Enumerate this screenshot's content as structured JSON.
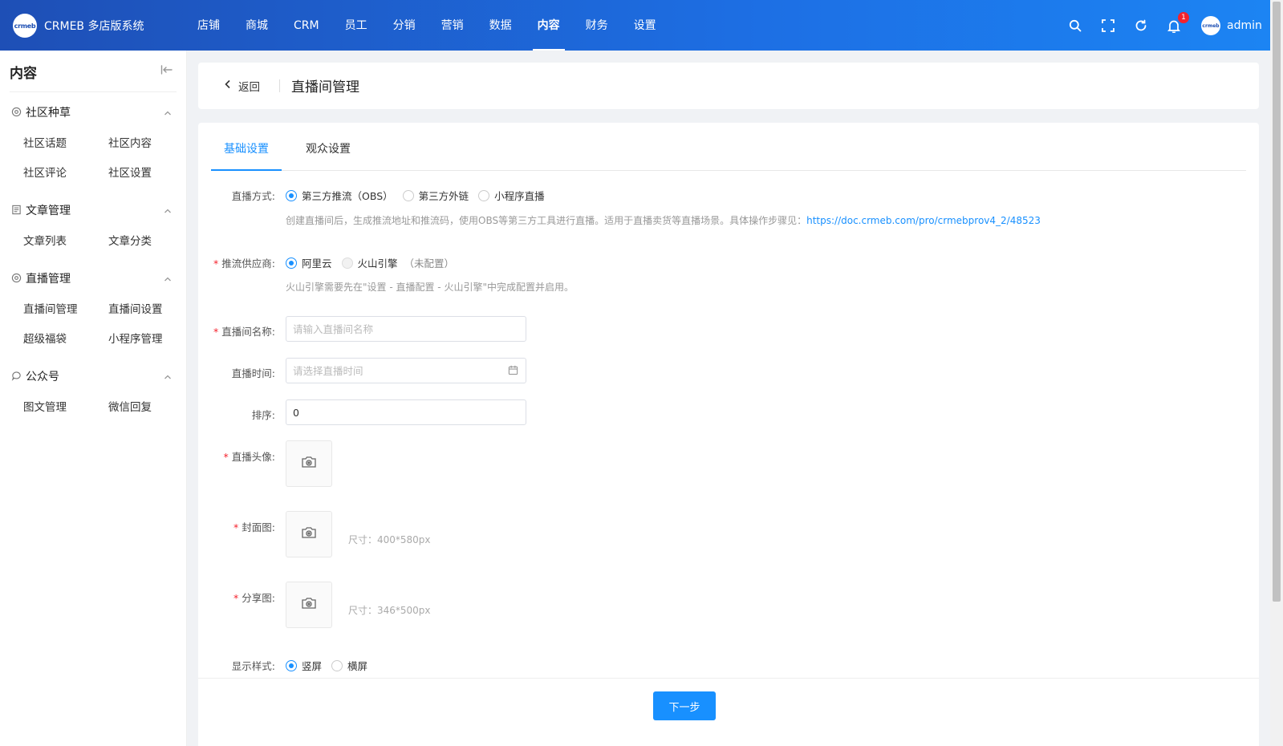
{
  "brand": {
    "logo_text": "crmeb",
    "name": "CRMEB 多店版系统"
  },
  "nav": [
    {
      "label": "店铺",
      "active": false
    },
    {
      "label": "商城",
      "active": false
    },
    {
      "label": "CRM",
      "active": false
    },
    {
      "label": "员工",
      "active": false
    },
    {
      "label": "分销",
      "active": false
    },
    {
      "label": "营销",
      "active": false
    },
    {
      "label": "数据",
      "active": false
    },
    {
      "label": "内容",
      "active": true
    },
    {
      "label": "财务",
      "active": false
    },
    {
      "label": "设置",
      "active": false
    }
  ],
  "header_tools": {
    "icons": [
      "search-icon",
      "fullscreen-icon",
      "refresh-icon",
      "bell-icon"
    ],
    "notification_count": "1",
    "avatar_text": "crmeb",
    "user_name": "admin"
  },
  "sidebar": {
    "title": "内容",
    "groups": [
      {
        "label": "社区种草",
        "icon": "community-icon",
        "items": [
          "社区话题",
          "社区内容",
          "社区评论",
          "社区设置"
        ]
      },
      {
        "label": "文章管理",
        "icon": "article-icon",
        "items": [
          "文章列表",
          "文章分类"
        ]
      },
      {
        "label": "直播管理",
        "icon": "live-icon",
        "items": [
          "直播间管理",
          "直播间设置",
          "超级福袋",
          "小程序管理"
        ]
      },
      {
        "label": "公众号",
        "icon": "wechat-icon",
        "items": [
          "图文管理",
          "微信回复"
        ]
      }
    ]
  },
  "page": {
    "back_label": "返回",
    "title": "直播间管理"
  },
  "tabs": [
    {
      "label": "基础设置",
      "active": true
    },
    {
      "label": "观众设置",
      "active": false
    }
  ],
  "form": {
    "live_mode": {
      "label": "直播方式:",
      "options": [
        "第三方推流（OBS）",
        "第三方外链",
        "小程序直播"
      ],
      "selected": 0,
      "hint_text": "创建直播间后，生成推流地址和推流码，使用OBS等第三方工具进行直播。适用于直播卖货等直播场景。具体操作步骤见：",
      "hint_link": "https://doc.crmeb.com/pro/crmebprov4_2/48523"
    },
    "provider": {
      "label": "推流供应商:",
      "options": [
        "阿里云",
        "火山引擎"
      ],
      "disabled_note": "（未配置）",
      "selected": 0,
      "hint_text": "火山引擎需要先在\"设置 - 直播配置 - 火山引擎\"中完成配置并启用。"
    },
    "room_name": {
      "label": "直播间名称:",
      "placeholder": "请输入直播间名称",
      "value": ""
    },
    "live_time": {
      "label": "直播时间:",
      "placeholder": "请选择直播时间"
    },
    "sort": {
      "label": "排序:",
      "value": "0"
    },
    "avatar": {
      "label": "直播头像:"
    },
    "cover": {
      "label": "封面图:",
      "size_hint": "尺寸：400*580px"
    },
    "share": {
      "label": "分享图:",
      "size_hint": "尺寸：346*500px"
    },
    "display_style": {
      "label": "显示样式:",
      "options": [
        "竖屏",
        "横屏"
      ],
      "selected": 0
    }
  },
  "footer": {
    "next_label": "下一步"
  },
  "colors": {
    "primary": "#1890ff",
    "header_start": "#1e4fb6",
    "header_end": "#1c84f3",
    "required": "#f5222d"
  }
}
